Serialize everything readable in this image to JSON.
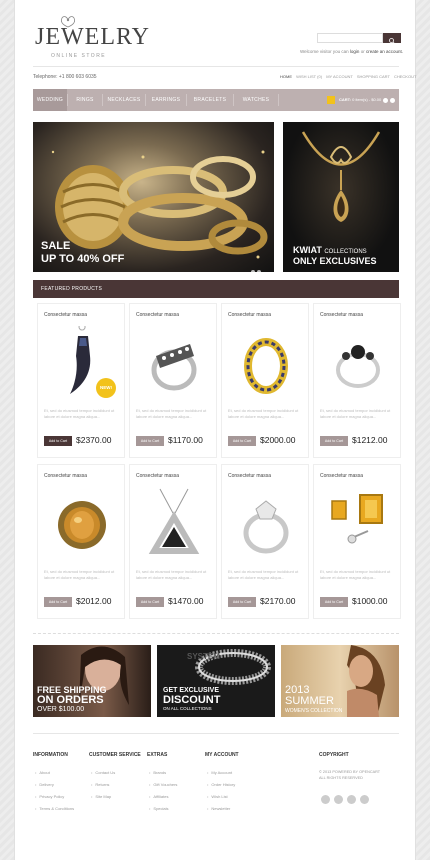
{
  "header": {
    "logo": "JEWELRY",
    "logo_sub": "ONLINE STORE",
    "search_placeholder": "",
    "welcome_prefix": "Welcome visitor you can",
    "login": "login",
    "welcome_or": "or",
    "create_account": "create an account.",
    "phone": "Telephone: +1 800 603 6035",
    "top_links": [
      "HOME",
      "WISH LIST (0)",
      "MY ACCOUNT",
      "SHOPPING CART",
      "CHECKOUT"
    ]
  },
  "nav": {
    "items": [
      "WEDDING",
      "RINGS",
      "NECKLACES",
      "EARRINGS",
      "BRACELETS",
      "WATCHES"
    ],
    "cart_label": "CART:",
    "cart_value": "0 item(s) - $0.00"
  },
  "banners": {
    "main_line1": "SALE",
    "main_line2": "UP TO 40% OFF",
    "side_line1": "KWIAT",
    "side_line1b": "COLLECTIONS",
    "side_line2": "ONLY EXCLUSIVES"
  },
  "featured_title": "FEATURED PRODUCTS",
  "products": [
    {
      "title": "Consectetur massa",
      "desc": "Et, sed do eiusmod tempor incididunt ut labore et dolore magna aliqua...",
      "add": "Add to Cart",
      "price": "$2370.00",
      "badge": "NEW!"
    },
    {
      "title": "Consectetur massa",
      "desc": "Et, sed do eiusmod tempor incididunt ut labore et dolore magna aliqua...",
      "add": "Add to Cart",
      "price": "$1170.00"
    },
    {
      "title": "Consectetur massa",
      "desc": "Et, sed do eiusmod tempor incididunt ut labore et dolore magna aliqua...",
      "add": "Add to Cart",
      "price": "$2000.00"
    },
    {
      "title": "Consectetur massa",
      "desc": "Et, sed do eiusmod tempor incididunt ut labore et dolore magna aliqua...",
      "add": "Add to Cart",
      "price": "$1212.00"
    },
    {
      "title": "Consectetur massa",
      "desc": "Et, sed do eiusmod tempor incididunt ut labore et dolore magna aliqua...",
      "add": "Add to Cart",
      "price": "$2012.00"
    },
    {
      "title": "Consectetur massa",
      "desc": "Et, sed do eiusmod tempor incididunt ut labore et dolore magna aliqua...",
      "add": "Add to Cart",
      "price": "$1470.00"
    },
    {
      "title": "Consectetur massa",
      "desc": "Et, sed do eiusmod tempor incididunt ut labore et dolore magna aliqua...",
      "add": "Add to Cart",
      "price": "$2170.00"
    },
    {
      "title": "Consectetur massa",
      "desc": "Et, sed do eiusmod tempor incididunt ut labore et dolore magna aliqua...",
      "add": "Add to Cart",
      "price": "$1000.00"
    }
  ],
  "promos": [
    {
      "l1": "FREE SHIPPING",
      "l2": "ON ORDERS",
      "l3": "OVER $100.00"
    },
    {
      "l1": "GET EXCLUSIVE",
      "l2": "DISCOUNT",
      "l3": "ON ALL COLLECTIONS"
    },
    {
      "l1": "2013",
      "l2": "SUMMER",
      "l3": "WOMEN'S COLLECTION"
    }
  ],
  "footer": {
    "information": {
      "title": "INFORMATION",
      "links": [
        "About",
        "Delivery",
        "Privacy Policy",
        "Terms & Conditions"
      ]
    },
    "customer": {
      "title": "CUSTOMER SERVICE",
      "links": [
        "Contact Us",
        "Returns",
        "Site Map"
      ]
    },
    "extras": {
      "title": "EXTRAS",
      "links": [
        "Brands",
        "Gift Vouchers",
        "Affiliates",
        "Specials"
      ]
    },
    "account": {
      "title": "MY ACCOUNT",
      "links": [
        "My Account",
        "Order History",
        "Wish List",
        "Newsletter"
      ]
    },
    "copyright": {
      "title": "COPYRIGHT",
      "line1": "© 2013 POWERED BY OPENCART",
      "line2": "ALL RIGHTS RESERVED"
    }
  },
  "colors": {
    "accent_dark": "#4a3636",
    "nav_bg": "#bdb0b0",
    "badge": "#f2c21b"
  }
}
